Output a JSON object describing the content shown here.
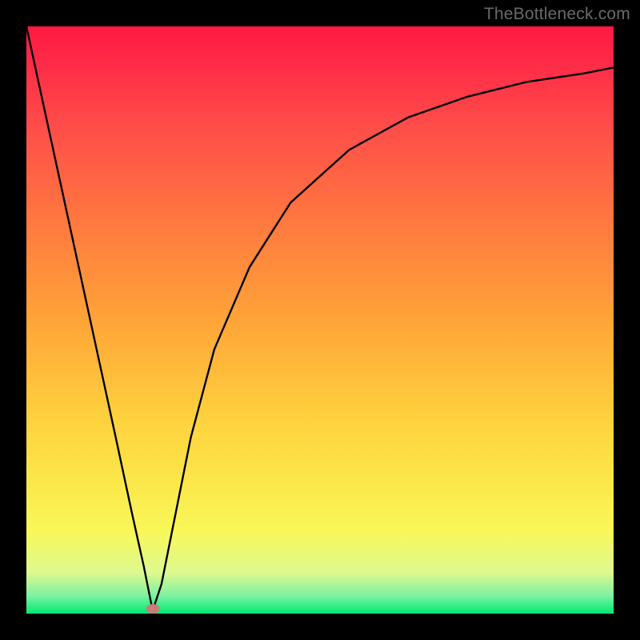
{
  "watermark": "TheBottleneck.com",
  "chart_data": {
    "type": "line",
    "title": "",
    "xlabel": "",
    "ylabel": "",
    "xlim": [
      0,
      100
    ],
    "ylim": [
      0,
      100
    ],
    "curve": {
      "x": [
        0,
        5,
        10,
        15,
        18,
        20,
        21.5,
        23,
        25,
        28,
        32,
        38,
        45,
        55,
        65,
        75,
        85,
        95,
        100
      ],
      "y": [
        100,
        77,
        54,
        31,
        17,
        8,
        0.5,
        5,
        15,
        30,
        45,
        59,
        70,
        79,
        84.5,
        88,
        90.5,
        92,
        93
      ]
    },
    "marker": {
      "x": 21.5,
      "y": 0.8
    },
    "background_gradient": {
      "top": "#ff1942",
      "mid_upper": "#ff7a3f",
      "mid": "#ffcf3d",
      "mid_lower": "#f9f759",
      "bottom": "#00e971"
    }
  }
}
